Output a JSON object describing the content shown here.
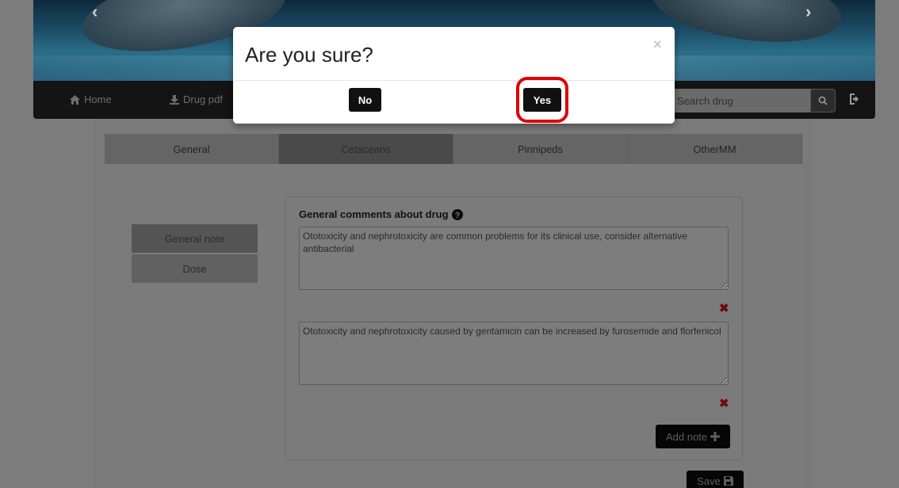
{
  "nav": {
    "home_label": "Home",
    "drug_pdf_label": "Drug pdf",
    "search_placeholder": "Search drug"
  },
  "tabs": [
    {
      "label": "General"
    },
    {
      "label": "Cetaceans"
    },
    {
      "label": "Pinnipeds"
    },
    {
      "label": "OtherMM"
    }
  ],
  "sidebar": {
    "general_note_label": "General note",
    "dose_label": "Dose"
  },
  "notes": {
    "title": "General comments about drug",
    "items": [
      {
        "text": "Ototoxicity and nephrotoxicity are common problems for its clinical use, consider alternative antibacterial"
      },
      {
        "text": "Ototoxicity and nephrotoxicity caused by gentamicin can be increased by furosemide and florfenicol"
      }
    ],
    "add_note_label": "Add note",
    "save_label": "Save"
  },
  "modal": {
    "title": "Are you sure?",
    "close_glyph": "×",
    "no_label": "No",
    "yes_label": "Yes"
  },
  "colors": {
    "highlight": "#e00000",
    "delete_icon": "#6e0d0d"
  }
}
